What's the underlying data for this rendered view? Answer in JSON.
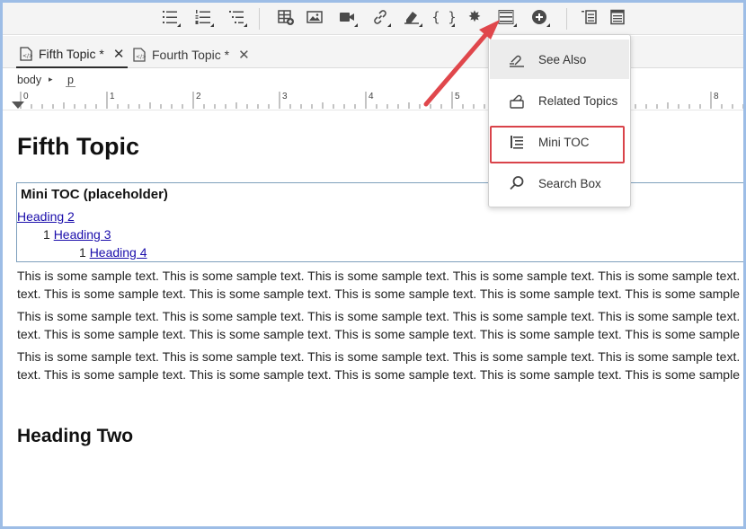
{
  "toolbar": {
    "buttons": [
      "bulleted-list",
      "numbered-list",
      "multilevel-list",
      "insert-table",
      "insert-image",
      "insert-video",
      "insert-link",
      "insert-snippet",
      "insert-variable",
      "insert-symbol",
      "insert-mini-toc",
      "insert-more",
      "toolbar-proxy",
      "toolbar-layout"
    ],
    "variable_glyph": "{ }",
    "symbol_glyph": "✸"
  },
  "tabs": [
    {
      "label": "Fifth Topic *",
      "close": "✕",
      "active": true
    },
    {
      "label": "Fourth Topic *",
      "close": "✕",
      "active": false
    }
  ],
  "breadcrumb": {
    "body": "body",
    "separator": "▸",
    "p": "p"
  },
  "ruler": {
    "numbers": [
      "0",
      "1",
      "2",
      "3",
      "4",
      "5",
      "8"
    ]
  },
  "editor": {
    "title": "Fifth Topic",
    "mini_toc": {
      "title": "Mini TOC (placeholder)",
      "entries": [
        {
          "prefix": "",
          "link": "Heading 2"
        },
        {
          "prefix": "1 ",
          "link": "Heading 3"
        },
        {
          "prefix": "1 ",
          "link": "Heading 4"
        }
      ]
    },
    "paragraphs": [
      {
        "line1": "This is some sample text. This is some sample text. This is some sample text. This is some sample text. This is some sample text. This is some sample te",
        "line2": "text. This is some sample text. This is some sample text. This is some sample text. This is some sample text. This is some sample text. This is some samp"
      },
      {
        "line1": "This is some sample text. This is some sample text. This is some sample text. This is some sample text. This is some sample text. This is some sample te",
        "line2": "text. This is some sample text. This is some sample text. This is some sample text. This is some sample text. This is some sample text. This is some samp"
      },
      {
        "line1": "This is some sample text. This is some sample text. This is some sample text. This is some sample text. This is some sample text. This is some sample te",
        "line2": "text. This is some sample text. This is some sample text. This is some sample text. This is some sample text. This is some sample text. This is some samp"
      }
    ],
    "heading_two": "Heading Two"
  },
  "dropdown": {
    "items": [
      {
        "label": "See Also",
        "icon": "see-also-icon",
        "hover": true
      },
      {
        "label": "Related Topics",
        "icon": "related-topics-icon",
        "hover": false
      },
      {
        "label": "Mini TOC",
        "icon": "mini-toc-icon",
        "hover": false,
        "highlighted": true
      },
      {
        "label": "Search Box",
        "icon": "search-icon",
        "hover": false
      }
    ]
  },
  "colors": {
    "highlight": "#d9434a",
    "arrow": "#e0474c",
    "link": "#1a0dab",
    "frame": "#9dbde6"
  }
}
